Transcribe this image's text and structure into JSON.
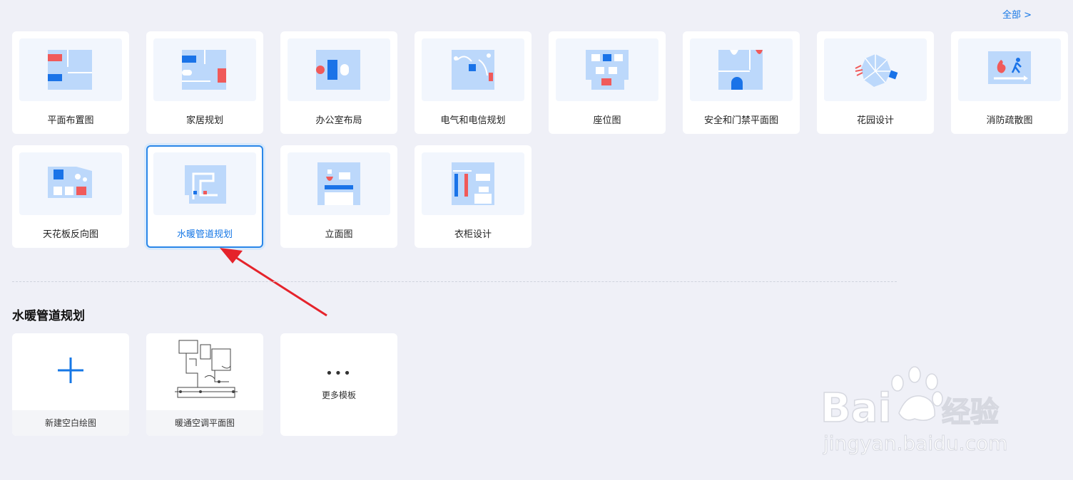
{
  "header": {
    "all_link": "全部 >"
  },
  "categories": [
    {
      "label": "平面布置图"
    },
    {
      "label": "家居规划"
    },
    {
      "label": "办公室布局"
    },
    {
      "label": "电气和电信规划"
    },
    {
      "label": "座位图"
    },
    {
      "label": "安全和门禁平面图"
    },
    {
      "label": "花园设计"
    },
    {
      "label": "消防疏散图"
    },
    {
      "label": "天花板反向图"
    },
    {
      "label": "水暖管道规划",
      "selected": true
    },
    {
      "label": "立面图"
    },
    {
      "label": "衣柜设计"
    }
  ],
  "section": {
    "title": "水暖管道规划",
    "templates": [
      {
        "label": "新建空白绘图",
        "icon": "plus-icon"
      },
      {
        "label": "暖通空调平面图"
      },
      {
        "dots": "•••",
        "label": "更多模板",
        "icon": "more-dots-icon"
      }
    ]
  },
  "watermark": {
    "text": "Baidu经验",
    "subtext": "jingyan.baidu.com"
  },
  "colors": {
    "accent": "#1677e6",
    "thumb_light": "#bcd8fb",
    "thumb_blue": "#1a73e8",
    "thumb_red": "#f05a5a"
  }
}
